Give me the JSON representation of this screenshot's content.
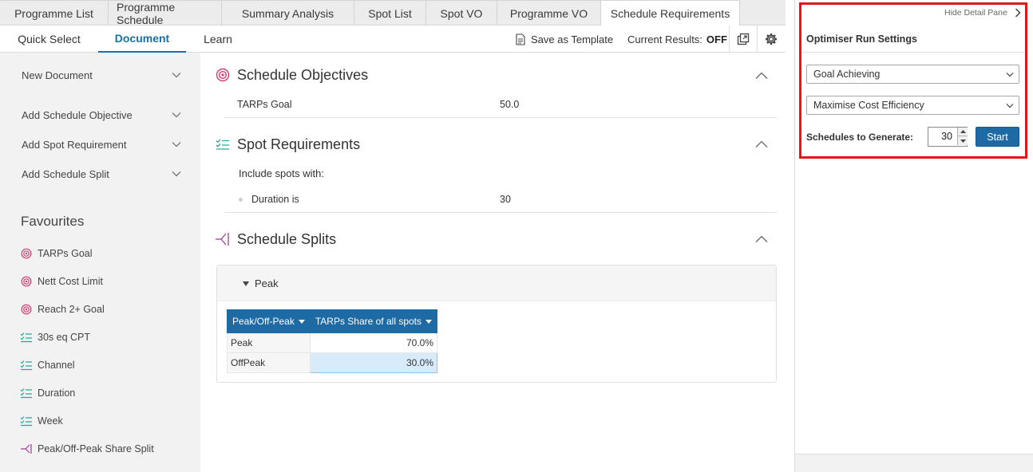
{
  "tabs": [
    {
      "label": "Programme List"
    },
    {
      "label": "Programme Schedule"
    },
    {
      "label": "Summary Analysis"
    },
    {
      "label": "Spot List"
    },
    {
      "label": "Spot VO"
    },
    {
      "label": "Programme VO"
    },
    {
      "label": "Schedule Requirements",
      "active": true
    }
  ],
  "subnav": {
    "quick_select": "Quick Select",
    "document": "Document",
    "learn": "Learn",
    "save_template": "Save as Template",
    "current_results_label": "Current Results:",
    "current_results_value": "OFF"
  },
  "sidebar": {
    "items": [
      {
        "label": "New Document"
      },
      {
        "label": "Add Schedule Objective"
      },
      {
        "label": "Add Spot Requirement"
      },
      {
        "label": "Add Schedule Split"
      }
    ],
    "favourites_title": "Favourites",
    "favourites": [
      {
        "label": "TARPs Goal",
        "icon": "target-icon"
      },
      {
        "label": "Nett Cost Limit",
        "icon": "target-icon"
      },
      {
        "label": "Reach 2+ Goal",
        "icon": "target-icon"
      },
      {
        "label": "30s eq CPT",
        "icon": "checklist-icon"
      },
      {
        "label": "Channel",
        "icon": "checklist-icon"
      },
      {
        "label": "Duration",
        "icon": "checklist-icon"
      },
      {
        "label": "Week",
        "icon": "checklist-icon"
      },
      {
        "label": "Peak/Off-Peak Share Split",
        "icon": "split-icon"
      }
    ]
  },
  "main": {
    "objectives": {
      "title": "Schedule Objectives",
      "rows": [
        {
          "label": "TARPs Goal",
          "value": "50.0"
        }
      ]
    },
    "spot_requirements": {
      "title": "Spot Requirements",
      "include_text": "Include spots with:",
      "rows": [
        {
          "label": "Duration is",
          "value": "30"
        }
      ]
    },
    "splits": {
      "title": "Schedule Splits",
      "group_name": "Peak",
      "columns": [
        "Peak/Off-Peak",
        "TARPs Share of all spots"
      ],
      "rows": [
        {
          "name": "Peak",
          "share": "70.0%"
        },
        {
          "name": "OffPeak",
          "share": "30.0%"
        }
      ]
    }
  },
  "detail_pane": {
    "hide_label": "Hide Detail Pane",
    "title": "Optimiser Run Settings",
    "goal_select": "Goal Achieving",
    "efficiency_select": "Maximise Cost Efficiency",
    "schedules_label": "Schedules to Generate:",
    "schedules_value": "30",
    "start_label": "Start"
  },
  "colors": {
    "accent": "#1d6aa5",
    "objective_icon": "#d63a6f",
    "checklist_icon": "#2aa89a",
    "split_icon": "#9b3fa0",
    "highlight": "#e3141c"
  }
}
